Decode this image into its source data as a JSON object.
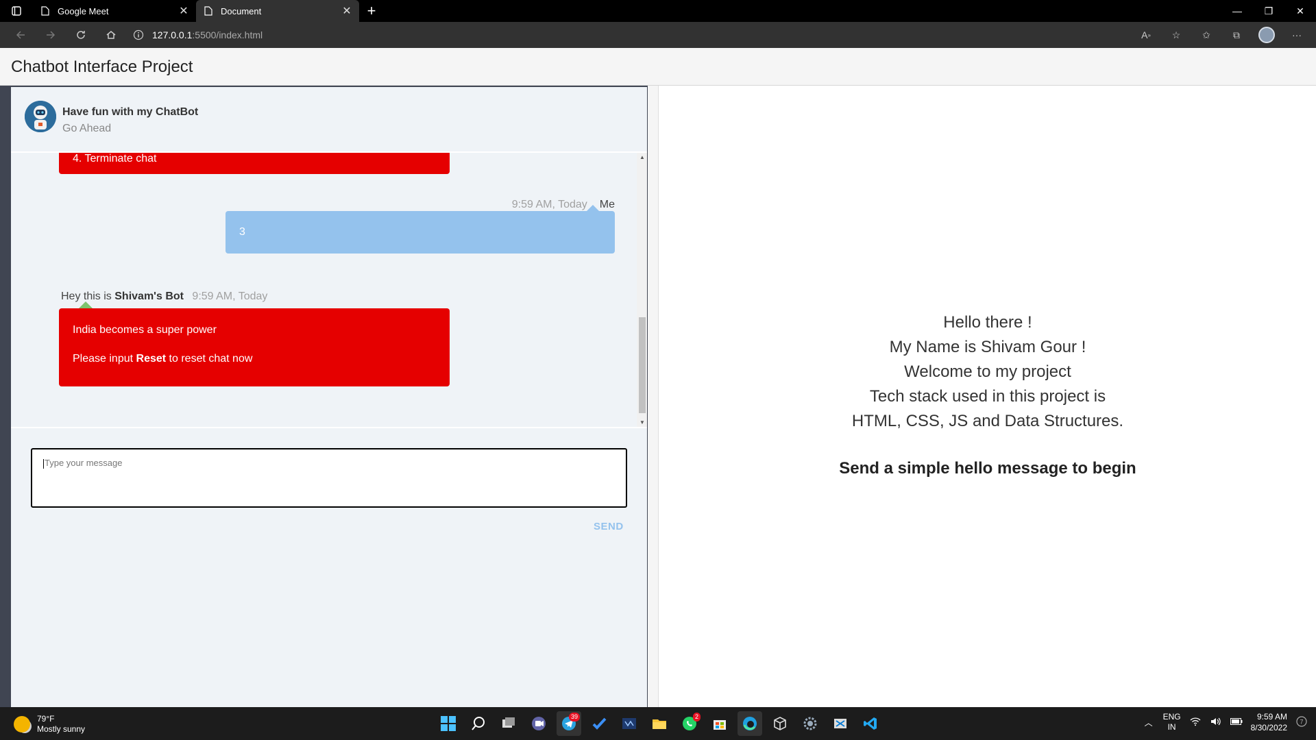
{
  "browser": {
    "tabs": [
      {
        "title": "Google Meet",
        "active": false
      },
      {
        "title": "Document",
        "active": true
      }
    ],
    "url_host": "127.0.0.1",
    "url_path": ":5500/index.html"
  },
  "page": {
    "title": "Chatbot Interface Project"
  },
  "chat": {
    "header_title": "Have fun with my ChatBot",
    "header_subtitle": "Go Ahead",
    "messages": {
      "bot_partial": "4. Terminate chat",
      "me_time": "9:59 AM, Today",
      "me_name": "Me",
      "me_text": "3",
      "bot_intro": "Hey this is",
      "bot_name": "Shivam's Bot",
      "bot_time": "9:59 AM, Today",
      "bot_line1": "India becomes a super power",
      "bot_line2_pre": "Please input",
      "bot_line2_bold": "Reset",
      "bot_line2_post": "to reset chat now"
    },
    "input_placeholder": "Type your message",
    "send_label": "SEND"
  },
  "intro": {
    "lines": [
      "Hello there !",
      "My Name is Shivam Gour !",
      "Welcome to my project",
      "Tech stack used in this project is",
      "HTML, CSS, JS and Data Structures."
    ],
    "cta": "Send a simple hello message to begin"
  },
  "taskbar": {
    "weather_temp": "79°F",
    "weather_desc": "Mostly sunny",
    "lang_top": "ENG",
    "lang_bottom": "IN",
    "time": "9:59 AM",
    "date": "8/30/2022",
    "badges": {
      "telegram": "39",
      "whatsapp": "2"
    }
  },
  "colors": {
    "bot_bubble": "#e50000",
    "me_bubble": "#94c2ed",
    "chat_bg": "#eff3f7",
    "sidebar_dark": "#404552"
  }
}
